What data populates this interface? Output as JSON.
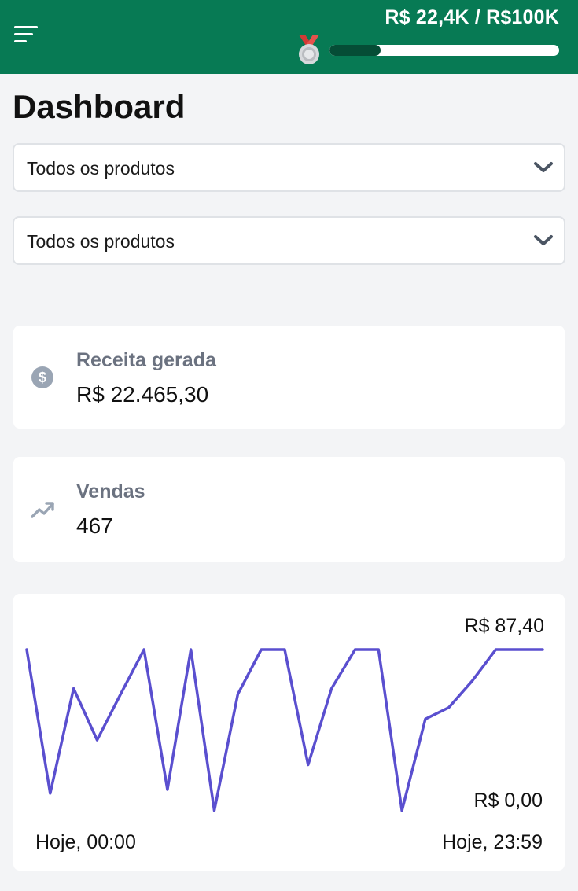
{
  "header": {
    "goal_text": "R$ 22,4K / R$100K",
    "progress_fraction": 0.224,
    "colors": {
      "background": "#077a54",
      "track": "#ffffff",
      "fill": "#054d36"
    }
  },
  "page": {
    "title": "Dashboard"
  },
  "filters": [
    {
      "value": "Todos os produtos"
    },
    {
      "value": "Todos os produtos"
    }
  ],
  "stats": {
    "revenue": {
      "label": "Receita gerada",
      "value": "R$ 22.465,30",
      "icon": "dollar-circle-icon"
    },
    "sales": {
      "label": "Vendas",
      "value": "467",
      "icon": "trending-up-icon"
    }
  },
  "chart_data": {
    "type": "line",
    "series": [
      {
        "values": [
          87.4,
          12,
          67,
          40,
          64,
          87.4,
          14,
          87.4,
          3,
          64,
          87.4,
          87.4,
          27,
          67,
          87.4,
          87.4,
          3,
          51,
          57,
          71,
          87.4,
          87.4,
          87.4
        ]
      }
    ],
    "x_start_label": "Hoje, 00:00",
    "x_end_label": "Hoje, 23:59",
    "y_max_label": "R$ 87,40",
    "y_min_label": "R$ 0,00",
    "ylim": [
      0,
      87.4
    ],
    "color": "#5a4fcf"
  }
}
